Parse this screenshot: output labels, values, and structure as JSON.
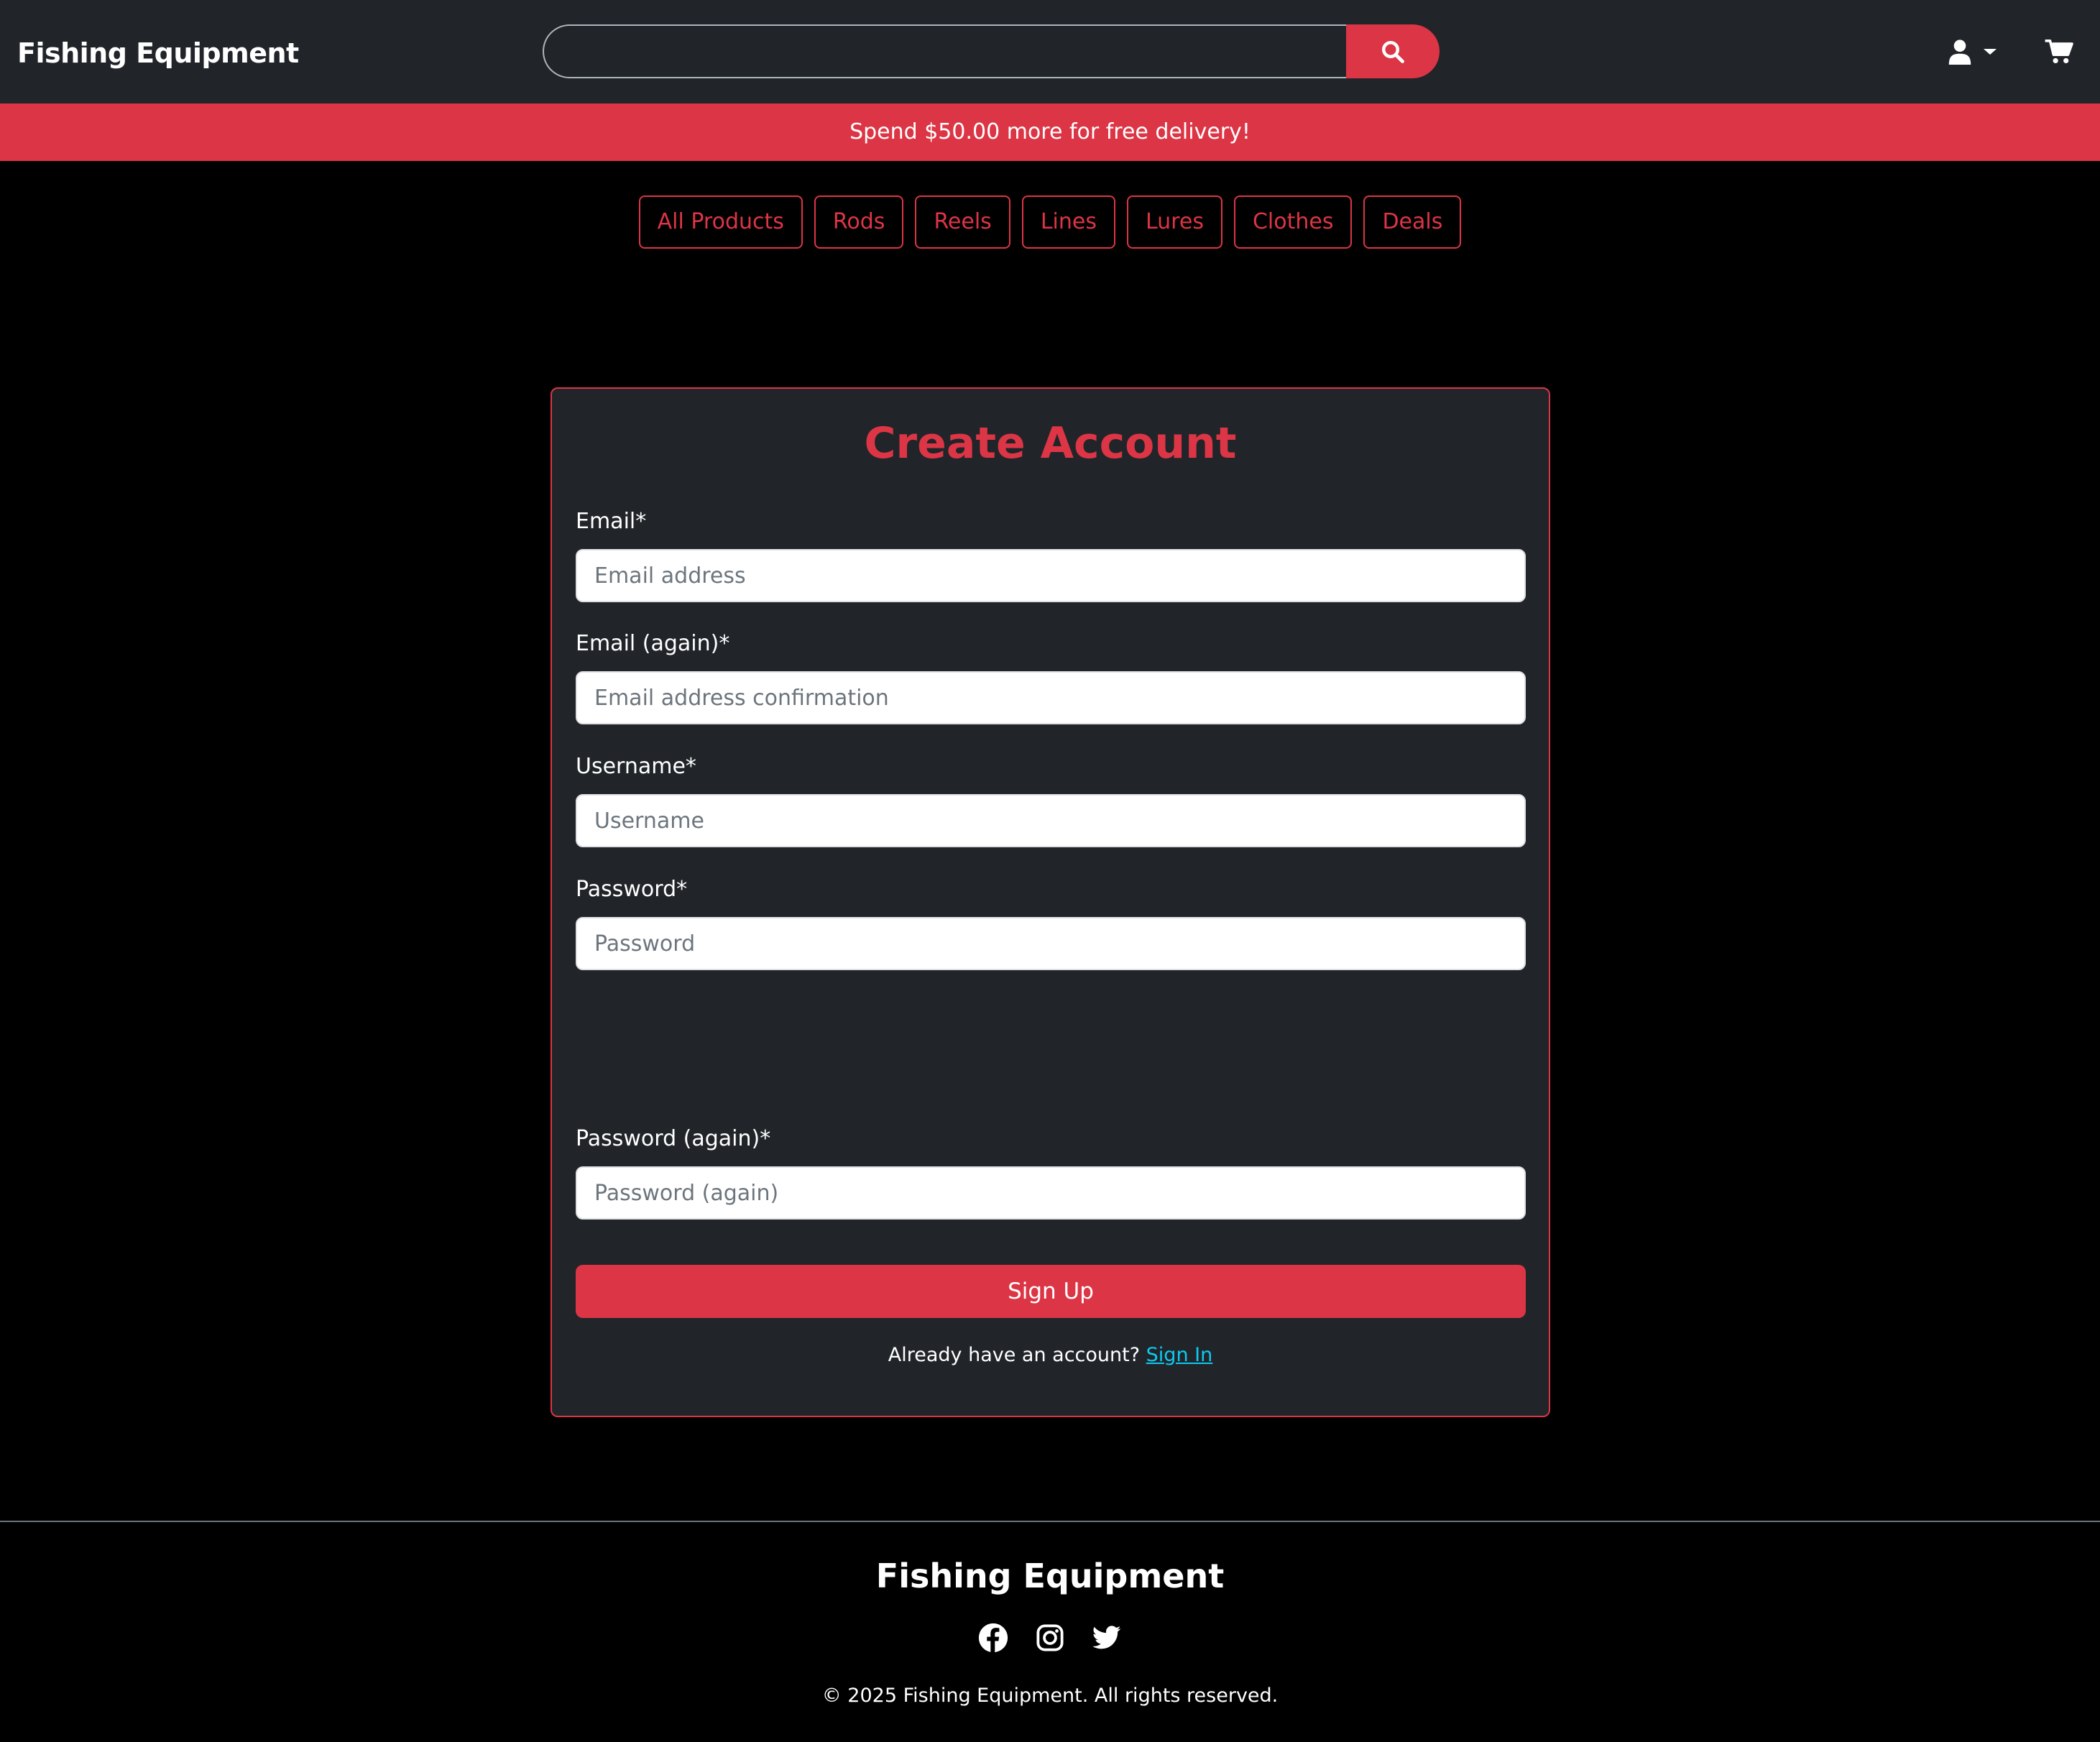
{
  "navbar": {
    "brand": "Fishing Equipment",
    "search_placeholder": "",
    "icons": {
      "search": "search-icon",
      "user": "user-icon",
      "caret": "caret-down-icon",
      "cart": "cart-icon"
    }
  },
  "promo": {
    "text": "Spend $50.00 more for free delivery!"
  },
  "categories": [
    "All Products",
    "Rods",
    "Reels",
    "Lines",
    "Lures",
    "Clothes",
    "Deals"
  ],
  "form": {
    "title": "Create Account",
    "fields": [
      {
        "label": "Email*",
        "placeholder": "Email address",
        "value": ""
      },
      {
        "label": "Email (again)*",
        "placeholder": "Email address confirmation",
        "value": ""
      },
      {
        "label": "Username*",
        "placeholder": "Username",
        "value": ""
      },
      {
        "label": "Password*",
        "placeholder": "Password",
        "value": ""
      },
      {
        "label": "Password (again)*",
        "placeholder": "Password (again)",
        "value": ""
      }
    ],
    "submit_label": "Sign Up",
    "signin_prompt": "Already have an account?",
    "signin_link": "Sign In"
  },
  "footer": {
    "brand": "Fishing Equipment",
    "socials": [
      "facebook-icon",
      "instagram-icon",
      "twitter-icon"
    ],
    "copyright": "© 2025 Fishing Equipment. All rights reserved."
  },
  "colors": {
    "accent": "#dc3545",
    "navbar_bg": "#212529",
    "page_bg": "#000000",
    "link": "#0dcaf0"
  }
}
